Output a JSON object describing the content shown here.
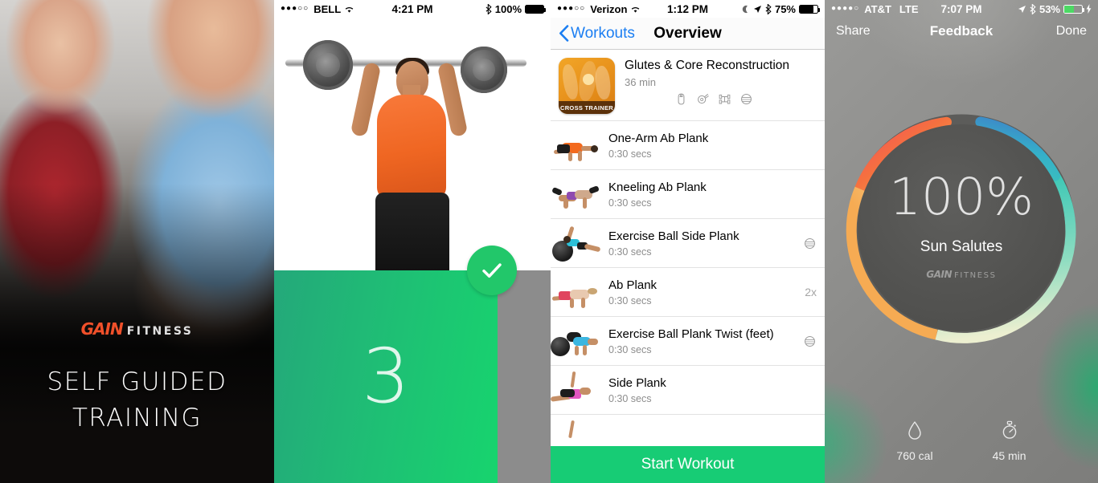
{
  "screens": {
    "splash": {
      "name": "self-guided-training-splash",
      "logo_gain": "GAIN",
      "logo_fitness": "FITNESS",
      "title_line1": "SELF GUIDED",
      "title_line2": "TRAINING"
    },
    "countdown": {
      "statusbar": {
        "dots": "●●●○○",
        "carrier": "BELL",
        "time": "4:21 PM",
        "battery_pct": "100%"
      },
      "count": "3",
      "check_icon": "checkmark-icon"
    },
    "overview": {
      "statusbar": {
        "dots": "●●●○○",
        "carrier": "Verizon",
        "time": "1:12 PM",
        "battery_pct": "75%"
      },
      "nav": {
        "back_label": "Workouts",
        "title": "Overview"
      },
      "workout": {
        "name": "Glutes & Core Reconstruction",
        "duration": "36 min",
        "badge": "CROSS TRAINER",
        "equipment": [
          "kettlebell-icon",
          "weight-plate-icon",
          "dumbbell-rack-icon",
          "exercise-ball-icon"
        ]
      },
      "exercises": [
        {
          "name": "One-Arm Ab Plank",
          "duration": "0:30 secs",
          "reps": "",
          "equipment": ""
        },
        {
          "name": "Kneeling Ab Plank",
          "duration": "0:30 secs",
          "reps": "",
          "equipment": ""
        },
        {
          "name": "Exercise Ball Side Plank",
          "duration": "0:30 secs",
          "reps": "",
          "equipment": "exercise-ball-icon"
        },
        {
          "name": "Ab Plank",
          "duration": "0:30 secs",
          "reps": "2x",
          "equipment": ""
        },
        {
          "name": "Exercise Ball Plank Twist (feet)",
          "duration": "0:30 secs",
          "reps": "",
          "equipment": "exercise-ball-icon"
        },
        {
          "name": "Side Plank",
          "duration": "0:30 secs",
          "reps": "",
          "equipment": ""
        }
      ],
      "start_button": "Start Workout"
    },
    "summary": {
      "statusbar": {
        "dots": "●●●●○",
        "carrier": "AT&T",
        "network": "LTE",
        "time": "7:07 PM",
        "battery_pct": "53%"
      },
      "toolbar": {
        "share": "Share",
        "title": "Feedback",
        "done": "Done"
      },
      "ring": {
        "percent": "100%",
        "workout_name": "Sun Salutes",
        "logo_gain": "GAIN",
        "logo_fitness": "FITNESS"
      },
      "stats": [
        {
          "icon": "flame-drop-icon",
          "value": "760 cal"
        },
        {
          "icon": "stopwatch-icon",
          "value": "45 min"
        }
      ]
    }
  },
  "colors": {
    "brand_green": "#17cc75",
    "check_green": "#22c76a",
    "logo_orange": "#f0502a",
    "ios_blue": "#1b7ef2"
  }
}
